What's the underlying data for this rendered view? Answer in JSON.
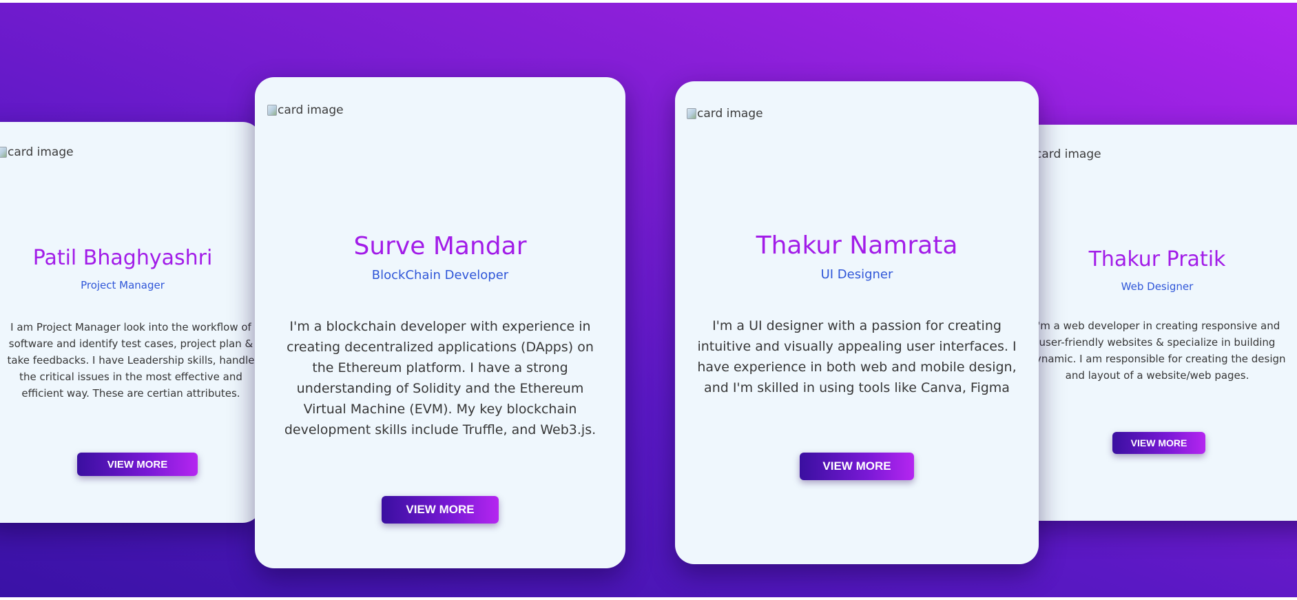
{
  "cards": [
    {
      "image_alt": "card image",
      "name": "Patil Bhaghyashri",
      "role": "Project Manager",
      "description_lines": [
        "I am Project Manager look into the workflow of",
        "software and identify test cases, project plan &",
        "take feedbacks. I have Leadership skills, handle",
        "the critical issues in the most effective and",
        "efficient way. These are certian attributes."
      ],
      "button_label": "VIEW MORE"
    },
    {
      "image_alt": "card image",
      "name": "Surve Mandar",
      "role": "BlockChain Developer",
      "description_lines": [
        "I'm a blockchain developer with experience in",
        "creating decentralized applications (DApps) on",
        "the Ethereum platform. I have a strong",
        "understanding of Solidity and the Ethereum",
        "Virtual Machine (EVM). My key blockchain",
        "development skills include Truffle, and Web3.js."
      ],
      "button_label": "VIEW MORE"
    },
    {
      "image_alt": "card image",
      "name": "Thakur Namrata",
      "role": "UI Designer",
      "description_lines": [
        "I'm a UI designer with a passion for creating",
        "intuitive and visually appealing user interfaces. I",
        "have experience in both web and mobile design,",
        "and I'm skilled in using tools like Canva, Figma"
      ],
      "button_label": "VIEW MORE"
    },
    {
      "image_alt": "card image",
      "name": "Thakur Pratik",
      "role": "Web Designer",
      "description_lines": [
        "I'm a web developer in creating responsive and",
        "user-friendly websites & specialize in building",
        "dynamic. I am responsible for creating the design",
        "and layout of a website/web pages."
      ],
      "button_label": "VIEW MORE"
    }
  ],
  "colors": {
    "background_start": "#3a12a6",
    "background_end": "#b024ef",
    "card_background": "#eff7fd",
    "name_color": "#a21ce8",
    "role_color": "#2f56d8"
  }
}
